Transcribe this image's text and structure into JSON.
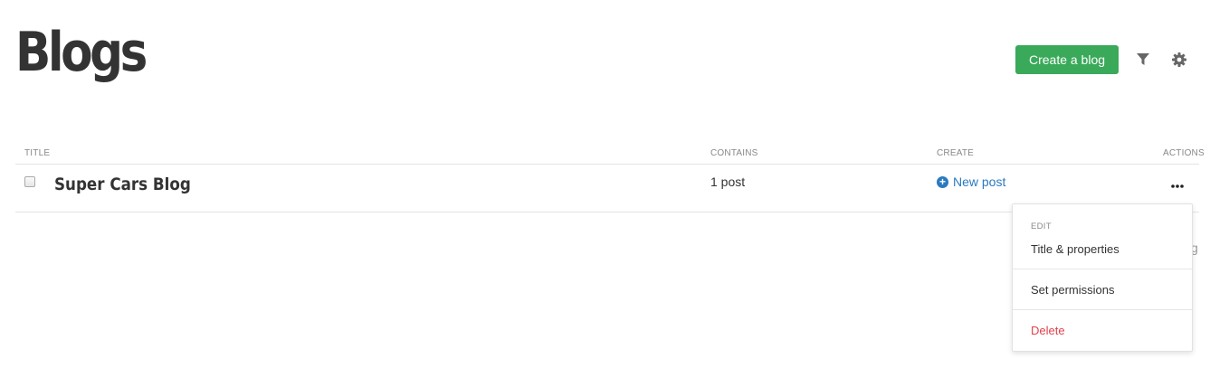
{
  "header": {
    "title": "Blogs",
    "create_button_label": "Create a blog"
  },
  "icons": {
    "filter": "filter-icon",
    "settings": "gear-icon",
    "more": "ellipsis-icon",
    "add": "plus-circle-icon"
  },
  "colors": {
    "primary_button": "#3aaa5a",
    "link": "#2a7ac0",
    "danger": "#e0424c"
  },
  "table": {
    "columns": [
      "TITLE",
      "CONTAINS",
      "CREATE",
      "ACTIONS"
    ],
    "rows": [
      {
        "title": "Super Cars Blog",
        "contains": "1 post",
        "create_label": "New post"
      }
    ]
  },
  "partially_hidden_text": "g",
  "actions_menu": {
    "section_label": "EDIT",
    "items": [
      "Title & properties",
      "Set permissions",
      "Delete"
    ]
  }
}
